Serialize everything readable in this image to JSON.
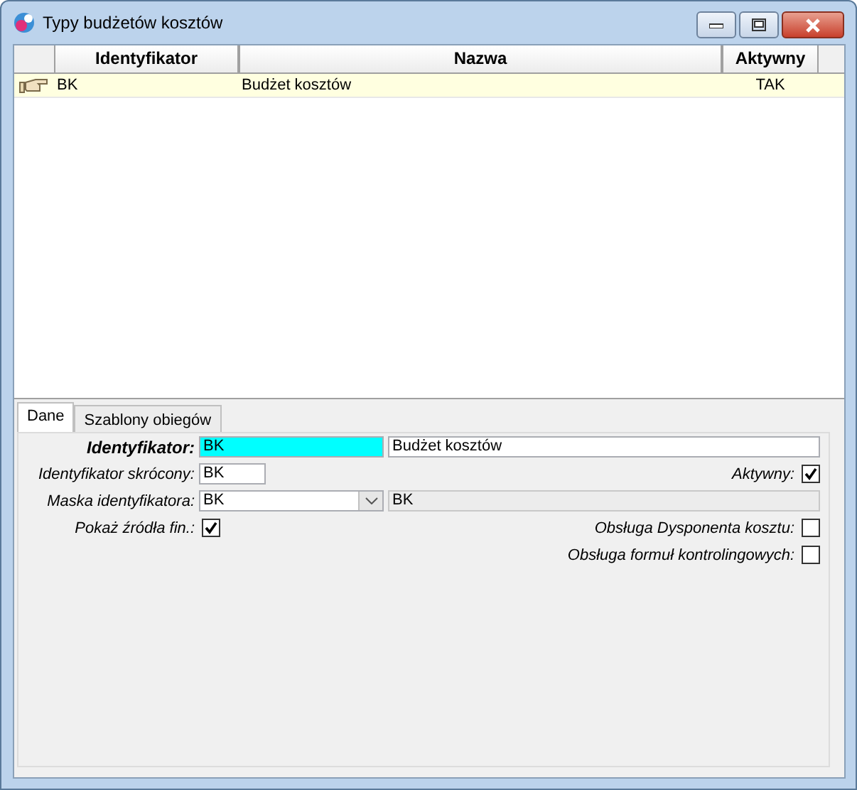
{
  "window": {
    "title": "Typy budżetów kosztów"
  },
  "grid": {
    "columns": [
      "Identyfikator",
      "Nazwa",
      "Aktywny"
    ],
    "rows": [
      {
        "cells": [
          "BK",
          "Budżet kosztów",
          "TAK"
        ],
        "selected": true
      }
    ]
  },
  "tabs": [
    {
      "label": "Dane",
      "selected": true
    },
    {
      "label": "Szablony obiegów",
      "selected": false
    }
  ],
  "form": {
    "identifier": {
      "label": "Identyfikator:",
      "code": "BK",
      "name": "Budżet kosztów"
    },
    "short_id": {
      "label": "Identyfikator skrócony:",
      "value": "BK"
    },
    "active": {
      "label": "Aktywny:",
      "checked": true
    },
    "mask": {
      "label": "Maska identyfikatora:",
      "value": "BK",
      "preview": "BK"
    },
    "show_sources": {
      "label": "Pokaż źródła fin.:",
      "checked": true
    },
    "dysponent": {
      "label": "Obsługa Dysponenta kosztu:",
      "checked": false
    },
    "formulas": {
      "label": "Obsługa formuł kontrolingowych:",
      "checked": false
    }
  }
}
